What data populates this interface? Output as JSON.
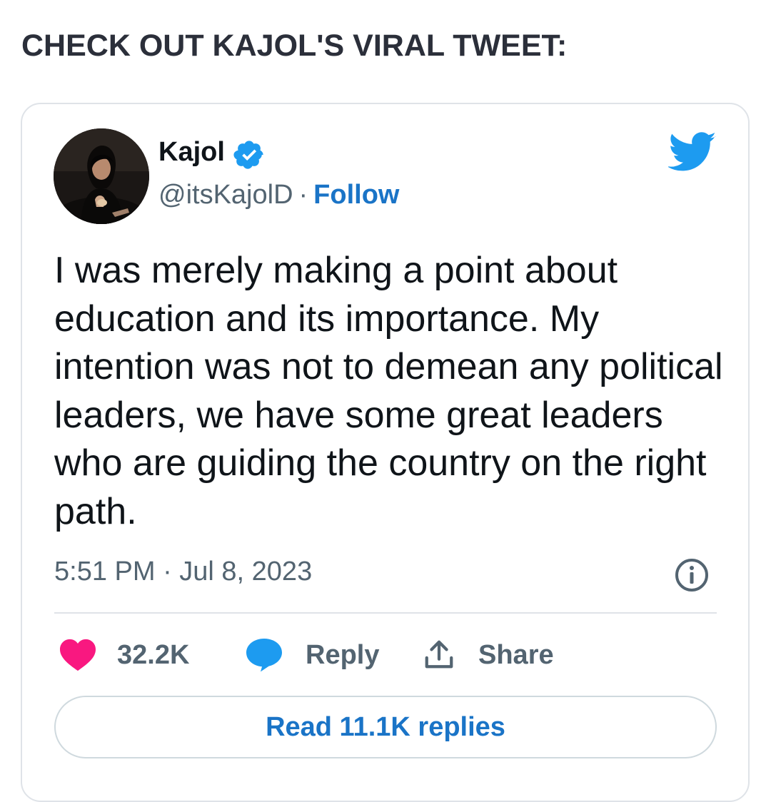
{
  "headline": "CHECK OUT KAJOL'S VIRAL TWEET:",
  "tweet": {
    "author_name": "Kajol",
    "handle": "@itsKajolD",
    "separator": "·",
    "follow_label": "Follow",
    "text": "I was merely making a point about education and its importance. My intention was not to demean any political leaders, we have some great leaders who are guiding the country on the right path.",
    "timestamp": "5:51 PM · Jul 8, 2023",
    "likes_count": "32.2K",
    "reply_label": "Reply",
    "share_label": "Share",
    "read_replies_label": "Read 11.1K replies"
  },
  "icons": {
    "verified": "verified-badge-icon",
    "brand": "twitter-bird-icon",
    "info": "info-icon",
    "like": "heart-icon",
    "reply": "speech-bubble-icon",
    "share": "share-upload-icon"
  },
  "colors": {
    "twitter_blue": "#1d9bf0",
    "link_blue": "#1a74c7",
    "heart_pink": "#f91880",
    "text_dark": "#0f1419",
    "text_gray": "#536471",
    "headline_dark": "#2b2f3a"
  }
}
